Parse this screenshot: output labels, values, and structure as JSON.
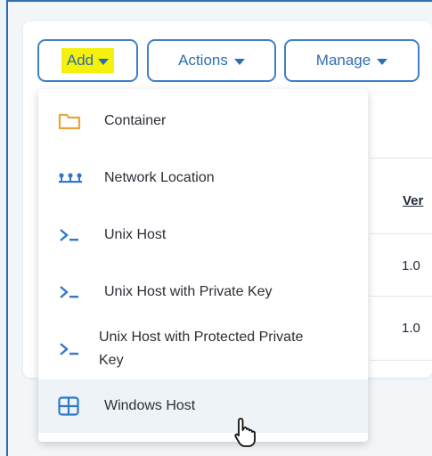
{
  "toolbar": {
    "add_label": "Add",
    "actions_label": "Actions",
    "manage_label": "Manage"
  },
  "table": {
    "column_header": "Ver",
    "rows": [
      "1.0",
      "1.0"
    ]
  },
  "menu": {
    "items": [
      {
        "label": "Container",
        "icon": "folder-icon"
      },
      {
        "label": "Network Location",
        "icon": "network-icon"
      },
      {
        "label": "Unix Host",
        "icon": "terminal-icon"
      },
      {
        "label": "Unix Host with Private Key",
        "icon": "terminal-icon"
      },
      {
        "label": "Unix Host with Protected Private Key",
        "icon": "terminal-icon"
      },
      {
        "label": "Windows Host",
        "icon": "windows-icon",
        "hovered": true
      }
    ]
  },
  "colors": {
    "accent": "#2f6fb0",
    "highlight": "#f5f10a",
    "folder": "#f0a23a"
  }
}
